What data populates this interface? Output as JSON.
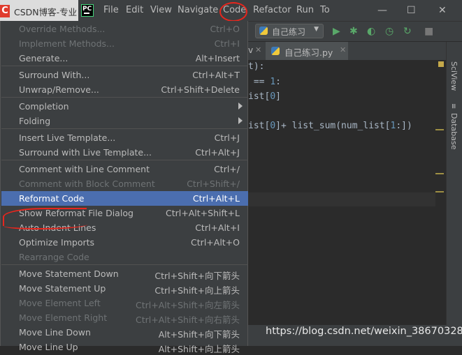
{
  "browser_tab": {
    "title": "CSDN博客-专业",
    "logo": "C"
  },
  "menubar": {
    "items": [
      {
        "label": "File",
        "name": "menu-file"
      },
      {
        "label": "Edit",
        "name": "menu-edit"
      },
      {
        "label": "View",
        "name": "menu-view"
      },
      {
        "label": "Navigate",
        "name": "menu-navigate"
      },
      {
        "label": "Code",
        "name": "menu-code"
      },
      {
        "label": "Refactor",
        "name": "menu-refactor"
      },
      {
        "label": "Run",
        "name": "menu-run"
      },
      {
        "label": "Tools",
        "name": "menu-tools"
      }
    ],
    "code": "Code",
    "file": "File",
    "edit": "Edit",
    "view": "View",
    "navigate": "Navigate",
    "refactor": "Refactor",
    "run": "Run",
    "tools": "To"
  },
  "window_controls": {
    "minimize": "—",
    "maximize": "☐",
    "close": "✕"
  },
  "toolbar": {
    "run_config": "自己练习"
  },
  "editor": {
    "tabs": {
      "partial_label": "v",
      "active_label": "自己练习.py"
    },
    "lines": [
      "t):",
      " == 1:",
      "ist[0]",
      "",
      "ist[0]+ list_sum(num_list[1:])"
    ]
  },
  "right_panel": {
    "sciview": "SciView",
    "database": "Database"
  },
  "watermark": "https://blog.csdn.net/weixin_38670328",
  "code_menu": [
    {
      "label": "Override Methods...",
      "shortcut": "Ctrl+O",
      "disabled": true
    },
    {
      "label": "Implement Methods...",
      "shortcut": "Ctrl+I",
      "disabled": true
    },
    {
      "label": "Generate...",
      "shortcut": "Alt+Insert",
      "disabled": false
    },
    {
      "label": "Surround With...",
      "shortcut": "Ctrl+Alt+T",
      "disabled": false
    },
    {
      "label": "Unwrap/Remove...",
      "shortcut": "Ctrl+Shift+Delete",
      "disabled": false
    },
    {
      "label": "Completion",
      "shortcut": "",
      "disabled": false,
      "submenu": true
    },
    {
      "label": "Folding",
      "shortcut": "",
      "disabled": false,
      "submenu": true
    },
    {
      "label": "Insert Live Template...",
      "shortcut": "Ctrl+J",
      "disabled": false
    },
    {
      "label": "Surround with Live Template...",
      "shortcut": "Ctrl+Alt+J",
      "disabled": false
    },
    {
      "label": "Comment with Line Comment",
      "shortcut": "Ctrl+/",
      "disabled": false
    },
    {
      "label": "Comment with Block Comment",
      "shortcut": "Ctrl+Shift+/",
      "disabled": true
    },
    {
      "label": "Reformat Code",
      "shortcut": "Ctrl+Alt+L",
      "disabled": false,
      "selected": true
    },
    {
      "label": "Show Reformat File Dialog",
      "shortcut": "Ctrl+Alt+Shift+L",
      "disabled": false
    },
    {
      "label": "Auto-Indent Lines",
      "shortcut": "Ctrl+Alt+I",
      "disabled": false
    },
    {
      "label": "Optimize Imports",
      "shortcut": "Ctrl+Alt+O",
      "disabled": false
    },
    {
      "label": "Rearrange Code",
      "shortcut": "",
      "disabled": true
    },
    {
      "label": "Move Statement Down",
      "shortcut": "Ctrl+Shift+向下箭头",
      "disabled": false
    },
    {
      "label": "Move Statement Up",
      "shortcut": "Ctrl+Shift+向上箭头",
      "disabled": false
    },
    {
      "label": "Move Element Left",
      "shortcut": "Ctrl+Alt+Shift+向左箭头",
      "disabled": true
    },
    {
      "label": "Move Element Right",
      "shortcut": "Ctrl+Alt+Shift+向右箭头",
      "disabled": true
    },
    {
      "label": "Move Line Down",
      "shortcut": "Alt+Shift+向下箭头",
      "disabled": false
    },
    {
      "label": "Move Line Up",
      "shortcut": "Alt+Shift+向上箭头",
      "disabled": false
    }
  ],
  "annotation_color": "#e8261d",
  "selection_color": "#4b6eaf"
}
